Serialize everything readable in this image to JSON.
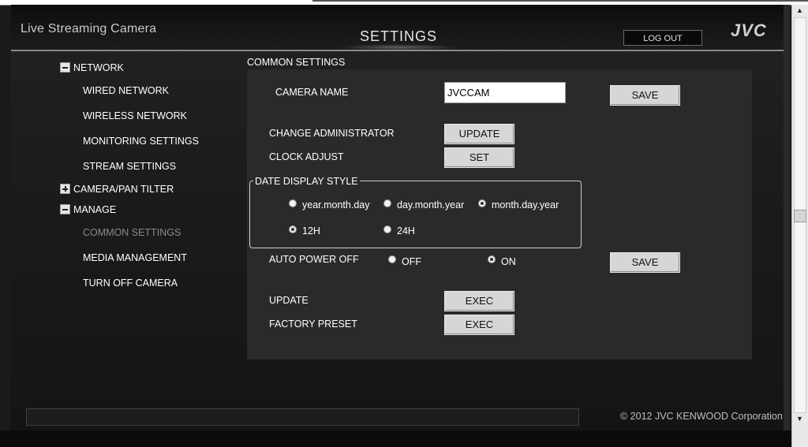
{
  "header": {
    "app_title": "Live Streaming Camera",
    "page_title": "SETTINGS",
    "logout_label": "LOG OUT",
    "brand": "JVC"
  },
  "sidebar": {
    "groups": [
      {
        "label": "NETWORK",
        "expanded": true,
        "items": [
          "WIRED NETWORK",
          "WIRELESS NETWORK",
          "MONITORING SETTINGS",
          "STREAM SETTINGS"
        ]
      },
      {
        "label": "CAMERA/PAN TILTER",
        "expanded": false,
        "items": []
      },
      {
        "label": "MANAGE",
        "expanded": true,
        "items": [
          "COMMON SETTINGS",
          "MEDIA MANAGEMENT",
          "TURN OFF CAMERA"
        ]
      }
    ],
    "selected": "COMMON SETTINGS"
  },
  "content": {
    "section_title": "COMMON SETTINGS",
    "camera_name": {
      "label": "CAMERA NAME",
      "value": "JVCCAM",
      "save_label": "SAVE"
    },
    "change_admin": {
      "label": "CHANGE ADMINISTRATOR",
      "button": "UPDATE"
    },
    "clock_adjust": {
      "label": "CLOCK ADJUST",
      "button": "SET"
    },
    "date_display": {
      "title": "DATE DISPLAY STYLE",
      "formats": [
        "year.month.day",
        "day.month.year",
        "month.day.year"
      ],
      "selected_format": "month.day.year",
      "hour_modes": [
        "12H",
        "24H"
      ],
      "selected_hour_mode": "12H"
    },
    "auto_power_off": {
      "label": "AUTO POWER OFF",
      "options": [
        "OFF",
        "ON"
      ],
      "selected": "ON",
      "save_label": "SAVE"
    },
    "update": {
      "label": "UPDATE",
      "button": "EXEC"
    },
    "factory_preset": {
      "label": "FACTORY PRESET",
      "button": "EXEC"
    }
  },
  "footer": {
    "copyright": "© 2012 JVC KENWOOD Corporation"
  }
}
